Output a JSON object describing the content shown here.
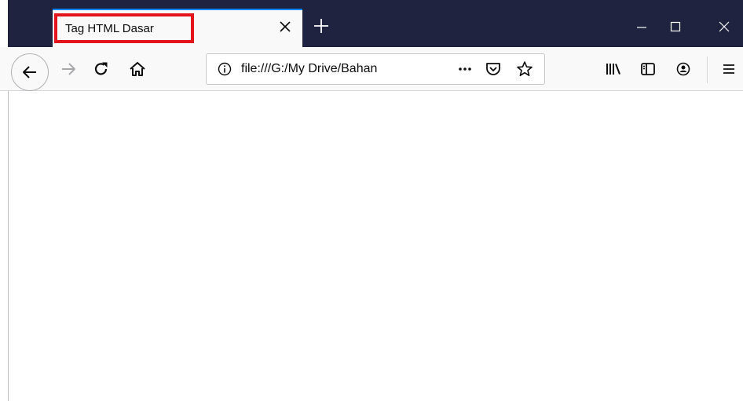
{
  "tab": {
    "title": "Tag HTML Dasar",
    "close_icon": "close-icon",
    "new_tab_icon": "plus-icon"
  },
  "window_controls": {
    "minimize_icon": "minimize-icon",
    "maximize_icon": "maximize-icon",
    "close_icon": "window-close-icon"
  },
  "toolbar": {
    "back_icon": "arrow-left-icon",
    "forward_icon": "arrow-right-icon",
    "reload_icon": "reload-icon",
    "home_icon": "home-icon",
    "url": "file:///G:/My Drive/Bahan",
    "info_icon": "info-icon",
    "page_actions_icon": "ellipsis-icon",
    "pocket_icon": "pocket-icon",
    "bookmark_icon": "star-icon",
    "library_icon": "library-icon",
    "sidebar_icon": "sidebar-icon",
    "account_icon": "account-icon",
    "menu_icon": "hamburger-menu-icon"
  },
  "colors": {
    "tabstrip": "#1f2340",
    "selected_tab": "#f9f9fa",
    "tab_highlight": "#0a84ff",
    "annotation_box": "#e3141c",
    "toolbar": "#f9f9fa"
  }
}
